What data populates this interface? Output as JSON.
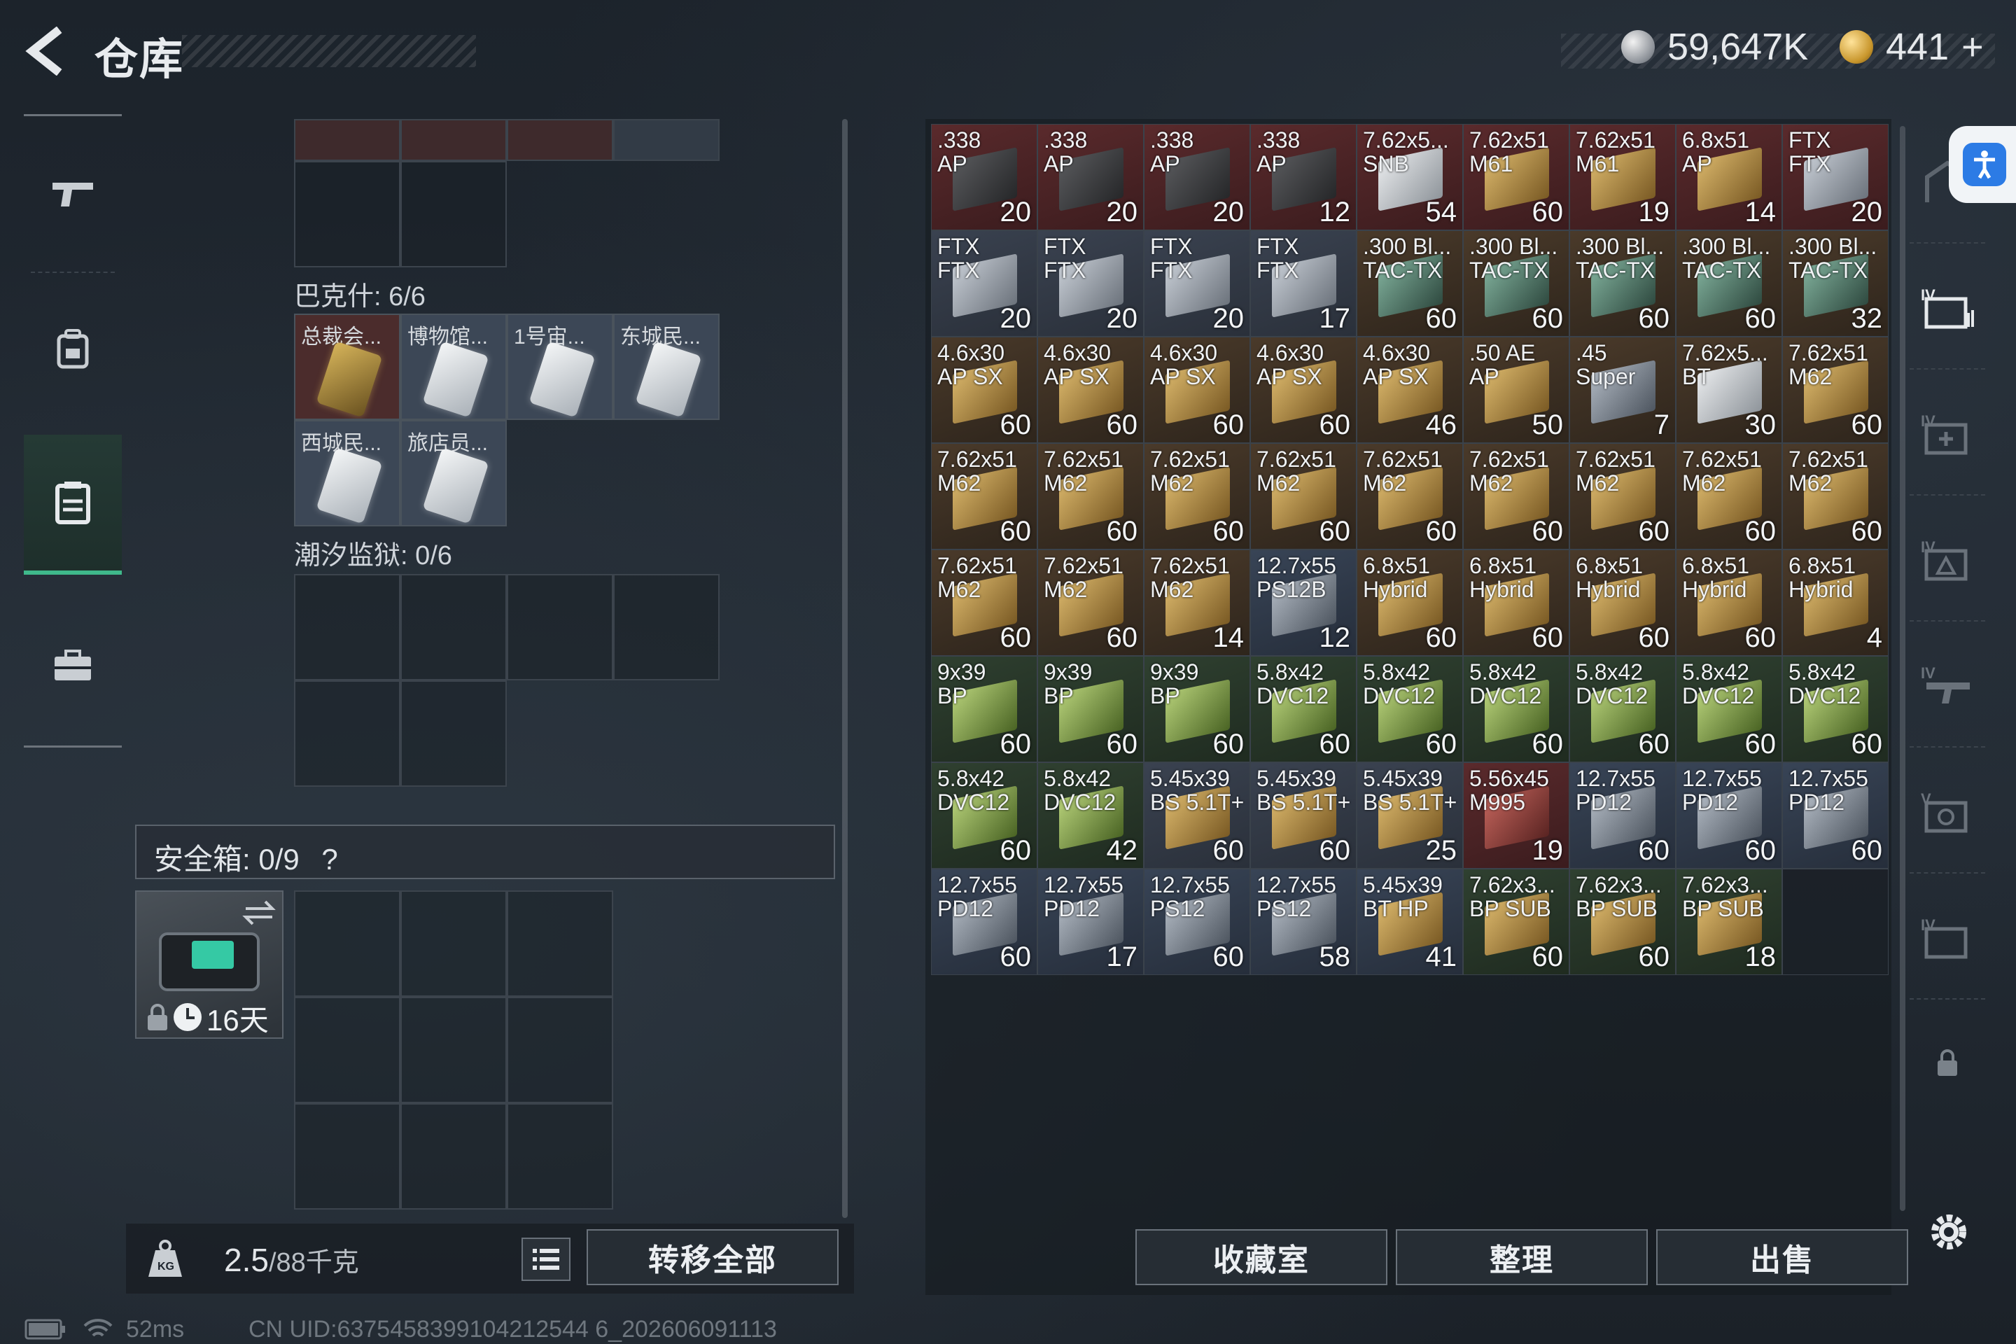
{
  "header": {
    "title": "仓库",
    "currency_a": "59,647K",
    "currency_b": "441",
    "add_label": "+"
  },
  "nav": {
    "items": [
      "weapons-tab",
      "gear-tab",
      "storage-tab",
      "case-tab"
    ]
  },
  "left": {
    "bakeshi_label": "巴克什: 6/6",
    "keys": [
      {
        "name": "总裁会...",
        "style": "gold"
      },
      {
        "name": "博物馆...",
        "style": "silver"
      },
      {
        "name": "1号宙...",
        "style": "silver"
      },
      {
        "name": "东城民...",
        "style": "silver"
      },
      {
        "name": "西城民...",
        "style": "silver"
      },
      {
        "name": "旅店员...",
        "style": "silver"
      }
    ],
    "prison_label": "潮汐监狱: 0/6",
    "safe_label": "安全箱:  0/9",
    "safe_help": "?",
    "safe_days": "16天",
    "weight": "2.5",
    "weight_max": "/88千克",
    "transfer_all": "转移全部"
  },
  "buttons": {
    "collection": "收藏室",
    "sort": "整理",
    "sell": "出售"
  },
  "status": {
    "latency": "52ms",
    "uid": "CN UID:6375458399104212544 6_202606091113"
  },
  "ammo": [
    {
      "a": ".338",
      "b": "AP",
      "q": "20",
      "t": "red",
      "c": "dark"
    },
    {
      "a": ".338",
      "b": "AP",
      "q": "20",
      "t": "red",
      "c": "dark"
    },
    {
      "a": ".338",
      "b": "AP",
      "q": "20",
      "t": "red",
      "c": "dark"
    },
    {
      "a": ".338",
      "b": "AP",
      "q": "12",
      "t": "red",
      "c": "dark"
    },
    {
      "a": "7.62x5...",
      "b": "SNB",
      "q": "54",
      "t": "red",
      "c": "white"
    },
    {
      "a": "7.62x51",
      "b": "M61",
      "q": "60",
      "t": "red",
      "c": "gold"
    },
    {
      "a": "7.62x51",
      "b": "M61",
      "q": "19",
      "t": "red",
      "c": "gold"
    },
    {
      "a": "6.8x51",
      "b": "AP",
      "q": "14",
      "t": "red",
      "c": "gold"
    },
    {
      "a": "FTX",
      "b": "FTX",
      "q": "20",
      "t": "red",
      "c": "silver"
    },
    {
      "a": "FTX",
      "b": "FTX",
      "q": "20",
      "t": "grey",
      "c": "silver"
    },
    {
      "a": "FTX",
      "b": "FTX",
      "q": "20",
      "t": "grey",
      "c": "silver"
    },
    {
      "a": "FTX",
      "b": "FTX",
      "q": "20",
      "t": "grey",
      "c": "silver"
    },
    {
      "a": "FTX",
      "b": "FTX",
      "q": "17",
      "t": "grey",
      "c": "silver"
    },
    {
      "a": ".300 Bl...",
      "b": "TAC-TX",
      "q": "60",
      "t": "brown",
      "c": "teal"
    },
    {
      "a": ".300 Bl...",
      "b": "TAC-TX",
      "q": "60",
      "t": "brown",
      "c": "teal"
    },
    {
      "a": ".300 Bl...",
      "b": "TAC-TX",
      "q": "60",
      "t": "brown",
      "c": "teal"
    },
    {
      "a": ".300 Bl...",
      "b": "TAC-TX",
      "q": "60",
      "t": "brown",
      "c": "teal"
    },
    {
      "a": ".300 Bl...",
      "b": "TAC-TX",
      "q": "32",
      "t": "brown",
      "c": "teal"
    },
    {
      "a": "4.6x30",
      "b": "AP SX",
      "q": "60",
      "t": "brown",
      "c": "gold"
    },
    {
      "a": "4.6x30",
      "b": "AP SX",
      "q": "60",
      "t": "brown",
      "c": "gold"
    },
    {
      "a": "4.6x30",
      "b": "AP SX",
      "q": "60",
      "t": "brown",
      "c": "gold"
    },
    {
      "a": "4.6x30",
      "b": "AP SX",
      "q": "60",
      "t": "brown",
      "c": "gold"
    },
    {
      "a": "4.6x30",
      "b": "AP SX",
      "q": "46",
      "t": "brown",
      "c": "gold"
    },
    {
      "a": ".50 AE",
      "b": "AP",
      "q": "50",
      "t": "brown",
      "c": "gold"
    },
    {
      "a": ".45",
      "b": "Super",
      "q": "7",
      "t": "brown",
      "c": "steel"
    },
    {
      "a": "7.62x5...",
      "b": "BT",
      "q": "30",
      "t": "brown",
      "c": "white"
    },
    {
      "a": "7.62x51",
      "b": "M62",
      "q": "60",
      "t": "brown",
      "c": "gold"
    },
    {
      "a": "7.62x51",
      "b": "M62",
      "q": "60",
      "t": "brown",
      "c": "gold"
    },
    {
      "a": "7.62x51",
      "b": "M62",
      "q": "60",
      "t": "brown",
      "c": "gold"
    },
    {
      "a": "7.62x51",
      "b": "M62",
      "q": "60",
      "t": "brown",
      "c": "gold"
    },
    {
      "a": "7.62x51",
      "b": "M62",
      "q": "60",
      "t": "brown",
      "c": "gold"
    },
    {
      "a": "7.62x51",
      "b": "M62",
      "q": "60",
      "t": "brown",
      "c": "gold"
    },
    {
      "a": "7.62x51",
      "b": "M62",
      "q": "60",
      "t": "brown",
      "c": "gold"
    },
    {
      "a": "7.62x51",
      "b": "M62",
      "q": "60",
      "t": "brown",
      "c": "gold"
    },
    {
      "a": "7.62x51",
      "b": "M62",
      "q": "60",
      "t": "brown",
      "c": "gold"
    },
    {
      "a": "7.62x51",
      "b": "M62",
      "q": "60",
      "t": "brown",
      "c": "gold"
    },
    {
      "a": "7.62x51",
      "b": "M62",
      "q": "60",
      "t": "brown",
      "c": "gold"
    },
    {
      "a": "7.62x51",
      "b": "M62",
      "q": "60",
      "t": "brown",
      "c": "gold"
    },
    {
      "a": "7.62x51",
      "b": "M62",
      "q": "14",
      "t": "brown",
      "c": "gold"
    },
    {
      "a": "12.7x55",
      "b": "PS12B",
      "q": "12",
      "t": "blue",
      "c": "steel"
    },
    {
      "a": "6.8x51",
      "b": "Hybrid",
      "q": "60",
      "t": "brown",
      "c": "gold"
    },
    {
      "a": "6.8x51",
      "b": "Hybrid",
      "q": "60",
      "t": "brown",
      "c": "gold"
    },
    {
      "a": "6.8x51",
      "b": "Hybrid",
      "q": "60",
      "t": "brown",
      "c": "gold"
    },
    {
      "a": "6.8x51",
      "b": "Hybrid",
      "q": "60",
      "t": "brown",
      "c": "gold"
    },
    {
      "a": "6.8x51",
      "b": "Hybrid",
      "q": "4",
      "t": "brown",
      "c": "gold"
    },
    {
      "a": "9x39",
      "b": "BP",
      "q": "60",
      "t": "green",
      "c": "green"
    },
    {
      "a": "9x39",
      "b": "BP",
      "q": "60",
      "t": "green",
      "c": "green"
    },
    {
      "a": "9x39",
      "b": "BP",
      "q": "60",
      "t": "green",
      "c": "green"
    },
    {
      "a": "5.8x42",
      "b": "DVC12",
      "q": "60",
      "t": "green",
      "c": "green"
    },
    {
      "a": "5.8x42",
      "b": "DVC12",
      "q": "60",
      "t": "green",
      "c": "green"
    },
    {
      "a": "5.8x42",
      "b": "DVC12",
      "q": "60",
      "t": "green",
      "c": "green"
    },
    {
      "a": "5.8x42",
      "b": "DVC12",
      "q": "60",
      "t": "green",
      "c": "green"
    },
    {
      "a": "5.8x42",
      "b": "DVC12",
      "q": "60",
      "t": "green",
      "c": "green"
    },
    {
      "a": "5.8x42",
      "b": "DVC12",
      "q": "60",
      "t": "green",
      "c": "green"
    },
    {
      "a": "5.8x42",
      "b": "DVC12",
      "q": "60",
      "t": "green",
      "c": "green"
    },
    {
      "a": "5.8x42",
      "b": "DVC12",
      "q": "42",
      "t": "green",
      "c": "green"
    },
    {
      "a": "5.45x39",
      "b": "BS 5.1T+",
      "q": "60",
      "t": "grey",
      "c": "gold"
    },
    {
      "a": "5.45x39",
      "b": "BS 5.1T+",
      "q": "60",
      "t": "grey",
      "c": "gold"
    },
    {
      "a": "5.45x39",
      "b": "BS 5.1T+",
      "q": "25",
      "t": "grey",
      "c": "gold"
    },
    {
      "a": "5.56x45",
      "b": "M995",
      "q": "19",
      "t": "red",
      "c": "red"
    },
    {
      "a": "12.7x55",
      "b": "PD12",
      "q": "60",
      "t": "blue",
      "c": "steel"
    },
    {
      "a": "12.7x55",
      "b": "PD12",
      "q": "60",
      "t": "blue",
      "c": "steel"
    },
    {
      "a": "12.7x55",
      "b": "PD12",
      "q": "60",
      "t": "blue",
      "c": "steel"
    },
    {
      "a": "12.7x55",
      "b": "PD12",
      "q": "60",
      "t": "blue",
      "c": "steel"
    },
    {
      "a": "12.7x55",
      "b": "PD12",
      "q": "17",
      "t": "blue",
      "c": "steel"
    },
    {
      "a": "12.7x55",
      "b": "PS12",
      "q": "60",
      "t": "blue",
      "c": "steel"
    },
    {
      "a": "12.7x55",
      "b": "PS12",
      "q": "58",
      "t": "blue",
      "c": "steel"
    },
    {
      "a": "5.45x39",
      "b": "BT HP",
      "q": "41",
      "t": "blue",
      "c": "gold"
    },
    {
      "a": "7.62x3...",
      "b": "BP SUB",
      "q": "60",
      "t": "green",
      "c": "gold"
    },
    {
      "a": "7.62x3...",
      "b": "BP SUB",
      "q": "60",
      "t": "green",
      "c": "gold"
    },
    {
      "a": "7.62x3...",
      "b": "BP SUB",
      "q": "18",
      "t": "green",
      "c": "gold"
    }
  ]
}
